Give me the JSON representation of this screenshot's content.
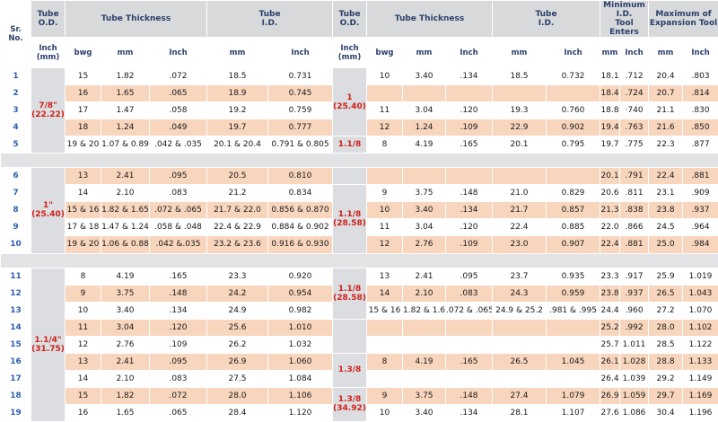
{
  "header": {
    "sr_no": "Sr.\nNo.",
    "tube_od": "Tube\nO.D.",
    "tube_thickness": "Tube Thickness",
    "tube_id": "Tube\nI.D.",
    "tube_od_2": "Tube\nO.D.",
    "tube_thickness_2": "Tube Thickness",
    "tube_id_2": "Tube\nI.D.",
    "min_id": "Minimum I.D.\nTool Enters",
    "max_exp": "Maximum of\nExpansion Tool"
  },
  "subheader": {
    "od_unit": "Inch\n(mm)",
    "bwg": "bwg",
    "mm": "mm",
    "inch": "Inch",
    "id_mm": "mm",
    "id_inch": "Inch",
    "od2_unit": "Inch\n(mm)",
    "bwg2": "bwg",
    "mm2": "mm",
    "inch2": "Inch",
    "id2_mm": "mm",
    "id2_inch": "Inch",
    "min_mm": "mm",
    "min_inch": "Inch",
    "max_mm": "mm",
    "max_inch": "Inch"
  },
  "groups": [
    {
      "od": "7/8\"\n(22.22)"
    },
    {
      "od": "1\"\n(25.40)"
    },
    {
      "od": "1.1/4\"\n(31.75)"
    }
  ],
  "od2_labels": {
    "g1_a": "1\n(25.40)",
    "g1_b": "1.1/8",
    "g2_a": "1.1/8\n(28.58)",
    "g3_a": "1.1/8\n(28.58)",
    "g3_b": "1.3/8",
    "g3_c": "1.3/8\n(34.92)"
  },
  "rows": [
    {
      "sr": "1",
      "bwg": "15",
      "mm": "1.82",
      "inch": ".072",
      "id_mm": "18.5",
      "id_inch": "0.731",
      "bwg2": "10",
      "mm2": "3.40",
      "inch2": ".134",
      "id2_mm": "18.5",
      "id2_inch": "0.732",
      "min_mm": "18.1",
      "min_inch": ".712",
      "max_mm": "20.4",
      "max_inch": ".803"
    },
    {
      "sr": "2",
      "bwg": "16",
      "mm": "1.65",
      "inch": ".065",
      "id_mm": "18.9",
      "id_inch": "0.745",
      "bwg2": "",
      "mm2": "",
      "inch2": "",
      "id2_mm": "",
      "id2_inch": "",
      "min_mm": "18.4",
      "min_inch": ".724",
      "max_mm": "20.7",
      "max_inch": ".814"
    },
    {
      "sr": "3",
      "bwg": "17",
      "mm": "1.47",
      "inch": ".058",
      "id_mm": "19.2",
      "id_inch": "0.759",
      "bwg2": "11",
      "mm2": "3.04",
      "inch2": ".120",
      "id2_mm": "19.3",
      "id2_inch": "0.760",
      "min_mm": "18.8",
      "min_inch": "·740",
      "max_mm": "21.1",
      "max_inch": ".830"
    },
    {
      "sr": "4",
      "bwg": "18",
      "mm": "1.24",
      "inch": ".049",
      "id_mm": "19.7",
      "id_inch": "0.777",
      "bwg2": "12",
      "mm2": "1.24",
      "inch2": ".109",
      "id2_mm": "22.9",
      "id2_inch": "0.902",
      "min_mm": "19.4",
      "min_inch": ".763",
      "max_mm": "21.6",
      "max_inch": ".850"
    },
    {
      "sr": "5",
      "bwg": "19 & 20",
      "mm": "1.07 & 0.89",
      "inch": ".042 & .035",
      "id_mm": "20.1 & 20.4",
      "id_inch": "0.791 & 0.805",
      "bwg2": "8",
      "mm2": "4.19",
      "inch2": ".165",
      "id2_mm": "20.1",
      "id2_inch": "0.795",
      "min_mm": "19.7",
      "min_inch": ".775",
      "max_mm": "22.3",
      "max_inch": ".877"
    },
    {
      "sr": "6",
      "bwg": "13",
      "mm": "2.41",
      "inch": ".095",
      "id_mm": "20.5",
      "id_inch": "0.810",
      "bwg2": "",
      "mm2": "",
      "inch2": "",
      "id2_mm": "",
      "id2_inch": "",
      "min_mm": "20.1",
      "min_inch": ".791",
      "max_mm": "22.4",
      "max_inch": ".881"
    },
    {
      "sr": "7",
      "bwg": "14",
      "mm": "2.10",
      "inch": ".083",
      "id_mm": "21.2",
      "id_inch": "0.834",
      "bwg2": "9",
      "mm2": "3.75",
      "inch2": ".148",
      "id2_mm": "21.0",
      "id2_inch": "0.829",
      "min_mm": "20.6",
      "min_inch": ".811",
      "max_mm": "23.1",
      "max_inch": ".909"
    },
    {
      "sr": "8",
      "bwg": "15 & 16",
      "mm": "1.82 & 1.65",
      "inch": ".072 & .065",
      "id_mm": "21.7 & 22.0",
      "id_inch": "0.856 & 0.870",
      "bwg2": "10",
      "mm2": "3.40",
      "inch2": ".134",
      "id2_mm": "21.7",
      "id2_inch": "0.857",
      "min_mm": "21.3",
      "min_inch": ".838",
      "max_mm": "23.8",
      "max_inch": ".937"
    },
    {
      "sr": "9",
      "bwg": "17 & 18",
      "mm": "1.47 & 1.24",
      "inch": ".058 & .048",
      "id_mm": "22.4 & 22.9",
      "id_inch": "0.884 & 0.902",
      "bwg2": "11",
      "mm2": "3.04",
      "inch2": ".120",
      "id2_mm": "22.4",
      "id2_inch": "0.885",
      "min_mm": "22.0",
      "min_inch": ".866",
      "max_mm": "24.5",
      "max_inch": ".964"
    },
    {
      "sr": "10",
      "bwg": "19 & 20",
      "mm": "1.06 & 0.88",
      "inch": ".042 &.035",
      "id_mm": "23.2 & 23.6",
      "id_inch": "0.916 & 0.930",
      "bwg2": "12",
      "mm2": "2.76",
      "inch2": ".109",
      "id2_mm": "23.0",
      "id2_inch": "0.907",
      "min_mm": "22.4",
      "min_inch": ".881",
      "max_mm": "25.0",
      "max_inch": ".984"
    },
    {
      "sr": "11",
      "bwg": "8",
      "mm": "4.19",
      "inch": ".165",
      "id_mm": "23.3",
      "id_inch": "0.920",
      "bwg2": "13",
      "mm2": "2.41",
      "inch2": ".095",
      "id2_mm": "23.7",
      "id2_inch": "0.935",
      "min_mm": "23.3",
      "min_inch": ".917",
      "max_mm": "25.9",
      "max_inch": "1.019"
    },
    {
      "sr": "12",
      "bwg": "9",
      "mm": "3.75",
      "inch": ".148",
      "id_mm": "24.2",
      "id_inch": "0.954",
      "bwg2": "14",
      "mm2": "2.10",
      "inch2": ".083",
      "id2_mm": "24.3",
      "id2_inch": "0.959",
      "min_mm": "23.8",
      "min_inch": ".937",
      "max_mm": "26.5",
      "max_inch": "1.043"
    },
    {
      "sr": "13",
      "bwg": "10",
      "mm": "3.40",
      "inch": ".134",
      "id_mm": "24.9",
      "id_inch": "0.982",
      "bwg2": "15 & 16",
      "mm2": "1.82 & 1.65",
      "inch2": ".072 & .065",
      "id2_mm": "24.9 & 25.2",
      "id2_inch": ".981 & .995",
      "min_mm": "24.4",
      "min_inch": ".960",
      "max_mm": "27.2",
      "max_inch": "1.070"
    },
    {
      "sr": "14",
      "bwg": "11",
      "mm": "3.04",
      "inch": ".120",
      "id_mm": "25.6",
      "id_inch": "1.010",
      "bwg2": "",
      "mm2": "",
      "inch2": "",
      "id2_mm": "",
      "id2_inch": "",
      "min_mm": "25.2",
      "min_inch": ".992",
      "max_mm": "28.0",
      "max_inch": "1.102"
    },
    {
      "sr": "15",
      "bwg": "12",
      "mm": "2.76",
      "inch": ".109",
      "id_mm": "26.2",
      "id_inch": "1.032",
      "bwg2": "",
      "mm2": "",
      "inch2": "",
      "id2_mm": "",
      "id2_inch": "",
      "min_mm": "25.7",
      "min_inch": "1.011",
      "max_mm": "28.5",
      "max_inch": "1.122"
    },
    {
      "sr": "16",
      "bwg": "13",
      "mm": "2.41",
      "inch": ".095",
      "id_mm": "26.9",
      "id_inch": "1.060",
      "bwg2": "8",
      "mm2": "4.19",
      "inch2": ".165",
      "id2_mm": "26.5",
      "id2_inch": "1.045",
      "min_mm": "26.1",
      "min_inch": "1.028",
      "max_mm": "28.8",
      "max_inch": "1.133"
    },
    {
      "sr": "17",
      "bwg": "14",
      "mm": "2.10",
      "inch": ".083",
      "id_mm": "27.5",
      "id_inch": "1.084",
      "bwg2": "",
      "mm2": "",
      "inch2": "",
      "id2_mm": "",
      "id2_inch": "",
      "min_mm": "26.4",
      "min_inch": "1.039",
      "max_mm": "29.2",
      "max_inch": "1.149"
    },
    {
      "sr": "18",
      "bwg": "15",
      "mm": "1.82",
      "inch": ".072",
      "id_mm": "28.0",
      "id_inch": "1.106",
      "bwg2": "9",
      "mm2": "3.75",
      "inch2": ".148",
      "id2_mm": "27.4",
      "id2_inch": "1.079",
      "min_mm": "26.9",
      "min_inch": "1.059",
      "max_mm": "29.7",
      "max_inch": "1.169"
    },
    {
      "sr": "19",
      "bwg": "16",
      "mm": "1.65",
      "inch": ".065",
      "id_mm": "28.4",
      "id_inch": "1.120",
      "bwg2": "10",
      "mm2": "3.40",
      "inch2": ".134",
      "id2_mm": "28.1",
      "id2_inch": "1.107",
      "min_mm": "27.6",
      "min_inch": "1.086",
      "max_mm": "30.4",
      "max_inch": "1.196"
    }
  ]
}
